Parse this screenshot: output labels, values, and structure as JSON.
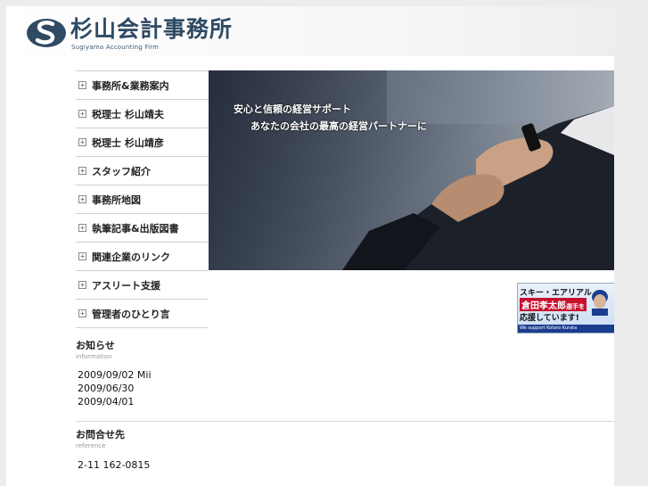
{
  "header": {
    "title": "杉山会計事務所",
    "subtitle": "Sugiyama Accounting Firm"
  },
  "nav": {
    "items": [
      {
        "label": "事務所&業務案内"
      },
      {
        "label": "税理士 杉山靖夫"
      },
      {
        "label": "税理士 杉山靖彦"
      },
      {
        "label": "スタッフ紹介"
      },
      {
        "label": "事務所地図"
      },
      {
        "label": "執筆記事&出版図書"
      },
      {
        "label": "関連企業のリンク"
      },
      {
        "label": "アスリート支援"
      },
      {
        "label": "管理者のひとり言"
      }
    ]
  },
  "hero": {
    "line1": "安心と信頼の経営サポート",
    "line2": "あなたの会社の最高の経営パートナーに"
  },
  "athlete_banner": {
    "line1": "スキー・エアリアル",
    "name": "倉田孝太郎",
    "name_suffix": "選手を",
    "line3": "応援しています!",
    "footer": "We support Kotaro Kurata"
  },
  "news": {
    "heading": "お知らせ",
    "heading_en": "information",
    "items": [
      {
        "date": "2009/09/02",
        "pre": "",
        "link": "",
        "post": " Mii "
      },
      {
        "date": "2009/06/30",
        "pre": "",
        "link": "",
        "post": ""
      },
      {
        "date": "2009/04/01",
        "pre": "",
        "link": "",
        "post": ""
      }
    ],
    "trailing": ""
  },
  "contact": {
    "heading": "お問合せ先",
    "heading_en": "reference",
    "link": " ",
    "address": "2-11 162-0815"
  },
  "colors": {
    "background": "#ececec",
    "logo_blue": "#2f4a63",
    "link_blue": "#1a1aff",
    "banner_red": "#c8102e"
  }
}
